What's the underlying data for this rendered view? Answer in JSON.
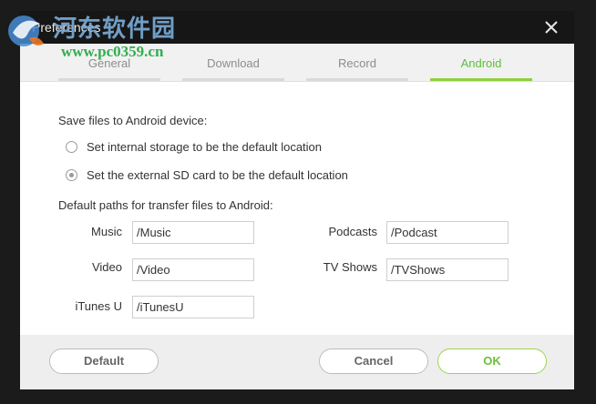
{
  "window": {
    "title": "Preferences"
  },
  "watermark": {
    "cn_text": "河东软件园",
    "url": "www.pc0359.cn"
  },
  "tabs": [
    {
      "label": "General",
      "active": false
    },
    {
      "label": "Download",
      "active": false
    },
    {
      "label": "Record",
      "active": false
    },
    {
      "label": "Android",
      "active": true
    }
  ],
  "android": {
    "save_heading": "Save files to Android device:",
    "options": [
      {
        "label": "Set internal storage to be the default location",
        "checked": false
      },
      {
        "label": "Set the external SD card to be the default location",
        "checked": true
      }
    ],
    "paths_heading": "Default paths for transfer files to Android:",
    "paths": {
      "music": {
        "label": "Music",
        "value": "/Music"
      },
      "podcasts": {
        "label": "Podcasts",
        "value": "/Podcast"
      },
      "video": {
        "label": "Video",
        "value": "/Video"
      },
      "tvshows": {
        "label": "TV Shows",
        "value": "/TVShows"
      },
      "itunesu": {
        "label": "iTunes U",
        "value": "/iTunesU"
      }
    }
  },
  "footer": {
    "default_label": "Default",
    "cancel_label": "Cancel",
    "ok_label": "OK"
  },
  "colors": {
    "accent": "#8ed13b",
    "active_tab_text": "#5bbf3a",
    "titlebar_bg": "#161616",
    "footer_bg": "#eeeeee"
  }
}
